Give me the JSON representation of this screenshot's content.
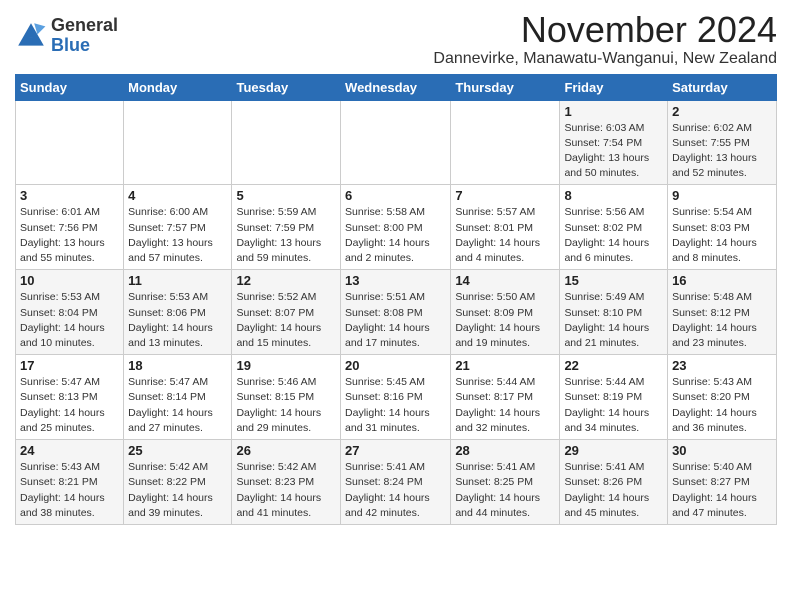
{
  "logo": {
    "general": "General",
    "blue": "Blue"
  },
  "title": "November 2024",
  "location": "Dannevirke, Manawatu-Wanganui, New Zealand",
  "days_of_week": [
    "Sunday",
    "Monday",
    "Tuesday",
    "Wednesday",
    "Thursday",
    "Friday",
    "Saturday"
  ],
  "weeks": [
    [
      {
        "day": "",
        "info": ""
      },
      {
        "day": "",
        "info": ""
      },
      {
        "day": "",
        "info": ""
      },
      {
        "day": "",
        "info": ""
      },
      {
        "day": "",
        "info": ""
      },
      {
        "day": "1",
        "info": "Sunrise: 6:03 AM\nSunset: 7:54 PM\nDaylight: 13 hours\nand 50 minutes."
      },
      {
        "day": "2",
        "info": "Sunrise: 6:02 AM\nSunset: 7:55 PM\nDaylight: 13 hours\nand 52 minutes."
      }
    ],
    [
      {
        "day": "3",
        "info": "Sunrise: 6:01 AM\nSunset: 7:56 PM\nDaylight: 13 hours\nand 55 minutes."
      },
      {
        "day": "4",
        "info": "Sunrise: 6:00 AM\nSunset: 7:57 PM\nDaylight: 13 hours\nand 57 minutes."
      },
      {
        "day": "5",
        "info": "Sunrise: 5:59 AM\nSunset: 7:59 PM\nDaylight: 13 hours\nand 59 minutes."
      },
      {
        "day": "6",
        "info": "Sunrise: 5:58 AM\nSunset: 8:00 PM\nDaylight: 14 hours\nand 2 minutes."
      },
      {
        "day": "7",
        "info": "Sunrise: 5:57 AM\nSunset: 8:01 PM\nDaylight: 14 hours\nand 4 minutes."
      },
      {
        "day": "8",
        "info": "Sunrise: 5:56 AM\nSunset: 8:02 PM\nDaylight: 14 hours\nand 6 minutes."
      },
      {
        "day": "9",
        "info": "Sunrise: 5:54 AM\nSunset: 8:03 PM\nDaylight: 14 hours\nand 8 minutes."
      }
    ],
    [
      {
        "day": "10",
        "info": "Sunrise: 5:53 AM\nSunset: 8:04 PM\nDaylight: 14 hours\nand 10 minutes."
      },
      {
        "day": "11",
        "info": "Sunrise: 5:53 AM\nSunset: 8:06 PM\nDaylight: 14 hours\nand 13 minutes."
      },
      {
        "day": "12",
        "info": "Sunrise: 5:52 AM\nSunset: 8:07 PM\nDaylight: 14 hours\nand 15 minutes."
      },
      {
        "day": "13",
        "info": "Sunrise: 5:51 AM\nSunset: 8:08 PM\nDaylight: 14 hours\nand 17 minutes."
      },
      {
        "day": "14",
        "info": "Sunrise: 5:50 AM\nSunset: 8:09 PM\nDaylight: 14 hours\nand 19 minutes."
      },
      {
        "day": "15",
        "info": "Sunrise: 5:49 AM\nSunset: 8:10 PM\nDaylight: 14 hours\nand 21 minutes."
      },
      {
        "day": "16",
        "info": "Sunrise: 5:48 AM\nSunset: 8:12 PM\nDaylight: 14 hours\nand 23 minutes."
      }
    ],
    [
      {
        "day": "17",
        "info": "Sunrise: 5:47 AM\nSunset: 8:13 PM\nDaylight: 14 hours\nand 25 minutes."
      },
      {
        "day": "18",
        "info": "Sunrise: 5:47 AM\nSunset: 8:14 PM\nDaylight: 14 hours\nand 27 minutes."
      },
      {
        "day": "19",
        "info": "Sunrise: 5:46 AM\nSunset: 8:15 PM\nDaylight: 14 hours\nand 29 minutes."
      },
      {
        "day": "20",
        "info": "Sunrise: 5:45 AM\nSunset: 8:16 PM\nDaylight: 14 hours\nand 31 minutes."
      },
      {
        "day": "21",
        "info": "Sunrise: 5:44 AM\nSunset: 8:17 PM\nDaylight: 14 hours\nand 32 minutes."
      },
      {
        "day": "22",
        "info": "Sunrise: 5:44 AM\nSunset: 8:19 PM\nDaylight: 14 hours\nand 34 minutes."
      },
      {
        "day": "23",
        "info": "Sunrise: 5:43 AM\nSunset: 8:20 PM\nDaylight: 14 hours\nand 36 minutes."
      }
    ],
    [
      {
        "day": "24",
        "info": "Sunrise: 5:43 AM\nSunset: 8:21 PM\nDaylight: 14 hours\nand 38 minutes."
      },
      {
        "day": "25",
        "info": "Sunrise: 5:42 AM\nSunset: 8:22 PM\nDaylight: 14 hours\nand 39 minutes."
      },
      {
        "day": "26",
        "info": "Sunrise: 5:42 AM\nSunset: 8:23 PM\nDaylight: 14 hours\nand 41 minutes."
      },
      {
        "day": "27",
        "info": "Sunrise: 5:41 AM\nSunset: 8:24 PM\nDaylight: 14 hours\nand 42 minutes."
      },
      {
        "day": "28",
        "info": "Sunrise: 5:41 AM\nSunset: 8:25 PM\nDaylight: 14 hours\nand 44 minutes."
      },
      {
        "day": "29",
        "info": "Sunrise: 5:41 AM\nSunset: 8:26 PM\nDaylight: 14 hours\nand 45 minutes."
      },
      {
        "day": "30",
        "info": "Sunrise: 5:40 AM\nSunset: 8:27 PM\nDaylight: 14 hours\nand 47 minutes."
      }
    ]
  ]
}
